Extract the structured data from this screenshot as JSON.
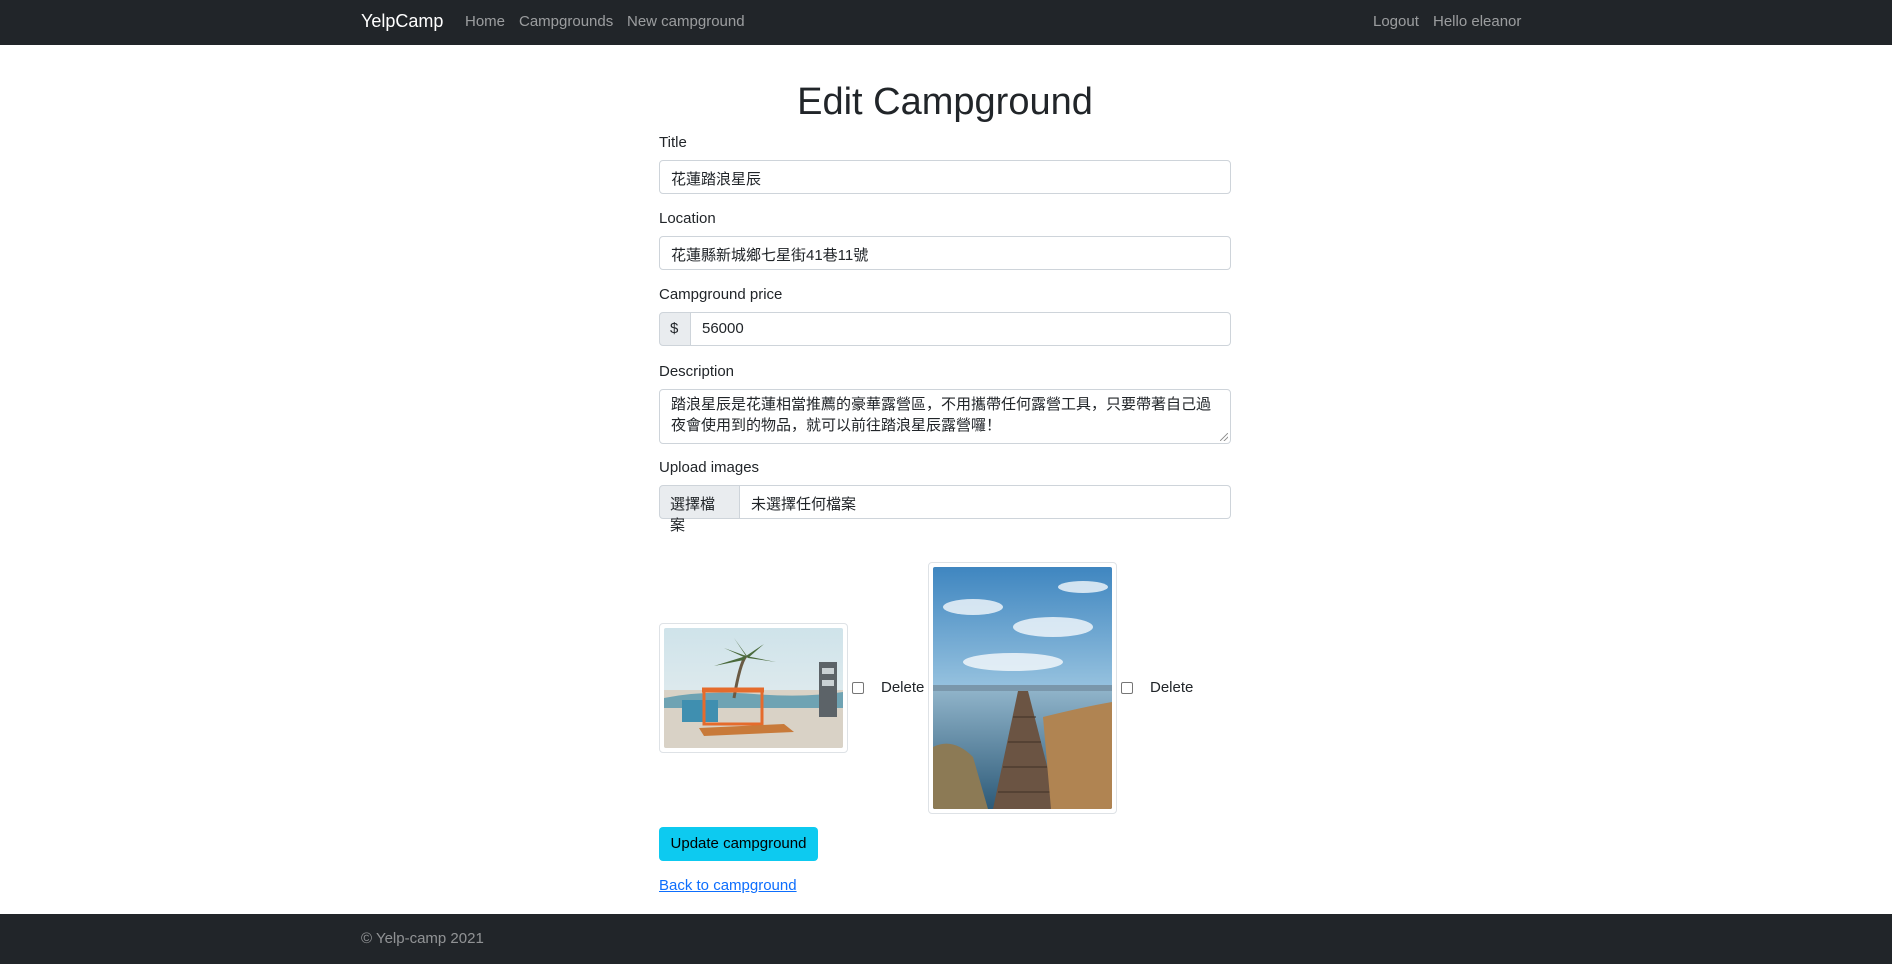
{
  "navbar": {
    "brand": "YelpCamp",
    "links": [
      "Home",
      "Campgrounds",
      "New campground"
    ],
    "right_links": [
      "Logout",
      "Hello eleanor"
    ]
  },
  "form": {
    "heading": "Edit Campground",
    "title_label": "Title",
    "title_value": "花蓮踏浪星辰",
    "location_label": "Location",
    "location_value": "花蓮縣新城鄉七星街41巷11號",
    "price_label": "Campground price",
    "price_prefix": "$",
    "price_value": "56000",
    "description_label": "Description",
    "description_value": "踏浪星辰是花蓮相當推薦的豪華露營區，不用攜帶任何露營工具，只要帶著自己過夜會使用到的物品，就可以前往踏浪星辰露營囉！",
    "upload_label": "Upload images",
    "upload_button": "選擇檔案",
    "upload_status": "未選擇任何檔案",
    "images": [
      {
        "delete_label": "Delete",
        "checked": false
      },
      {
        "delete_label": "Delete",
        "checked": false
      }
    ],
    "submit_label": "Update campground",
    "back_link": "Back to campground"
  },
  "footer": {
    "text": "© Yelp-camp 2021"
  },
  "colors": {
    "navbar_bg": "#212529",
    "submit_bg": "#0dcaf0",
    "link": "#0d6efd"
  }
}
